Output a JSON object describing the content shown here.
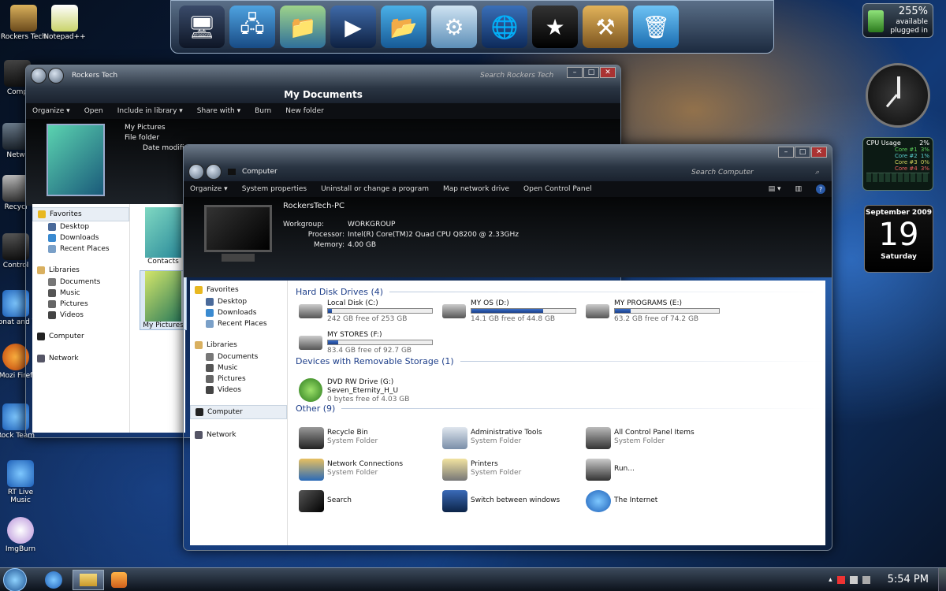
{
  "desktop": {
    "icons": [
      {
        "label": "Rockers Tech"
      },
      {
        "label": "Notepad++"
      },
      {
        "label": "Comp"
      },
      {
        "label": "Netw"
      },
      {
        "label": "Recycl"
      },
      {
        "label": "Control"
      },
      {
        "label": "Donat and Vi"
      },
      {
        "label": "Mozi Firef"
      },
      {
        "label": "Rock Team"
      },
      {
        "label": "RT Live Music"
      },
      {
        "label": "ImgBurn"
      }
    ]
  },
  "battery": {
    "percent": "255%",
    "status1": "available",
    "status2": "plugged in"
  },
  "cpu": {
    "title": "CPU Usage",
    "total": "2%",
    "cores": [
      {
        "name": "Core #1",
        "val": "3%"
      },
      {
        "name": "Core #2",
        "val": "1%"
      },
      {
        "name": "Core #3",
        "val": "0%"
      },
      {
        "name": "Core #4",
        "val": "3%"
      }
    ]
  },
  "calendar": {
    "month": "September 2009",
    "day": "19",
    "weekday": "Saturday"
  },
  "mydocs": {
    "address": "Rockers Tech",
    "title": "My Documents",
    "search": "Search Rockers Tech",
    "toolbar": [
      "Organize ▾",
      "Open",
      "Include in library ▾",
      "Share with ▾",
      "Burn",
      "New folder"
    ],
    "detail": {
      "name": "My Pictures",
      "type": "File folder",
      "date_label": "Date modified:"
    },
    "nav": {
      "favorites": "Favorites",
      "fav_items": [
        "Desktop",
        "Downloads",
        "Recent Places"
      ],
      "libraries": "Libraries",
      "lib_items": [
        "Documents",
        "Music",
        "Pictures",
        "Videos"
      ],
      "computer": "Computer",
      "network": "Network"
    },
    "folders": [
      "Contacts",
      "My Pictures"
    ]
  },
  "computer": {
    "address": "Computer",
    "search": "Search Computer",
    "toolbar": [
      "Organize ▾",
      "System properties",
      "Uninstall or change a program",
      "Map network drive",
      "Open Control Panel"
    ],
    "info": {
      "name": "RockersTech-PC",
      "workgroup_label": "Workgroup:",
      "workgroup": "WORKGROUP",
      "processor_label": "Processor:",
      "processor": "Intel(R) Core(TM)2 Quad CPU   Q8200  @ 2.33GHz",
      "memory_label": "Memory:",
      "memory": "4.00 GB"
    },
    "nav": {
      "favorites": "Favorites",
      "fav_items": [
        "Desktop",
        "Downloads",
        "Recent Places"
      ],
      "libraries": "Libraries",
      "lib_items": [
        "Documents",
        "Music",
        "Pictures",
        "Videos"
      ],
      "computer": "Computer",
      "network": "Network"
    },
    "groups": {
      "hdd": "Hard Disk Drives (4)",
      "removable": "Devices with Removable Storage (1)",
      "other": "Other (9)"
    },
    "drives": [
      {
        "name": "Local Disk (C:)",
        "free": "242 GB free of 253 GB",
        "used": 0.04
      },
      {
        "name": "MY OS (D:)",
        "free": "14.1 GB free of 44.8 GB",
        "used": 0.69
      },
      {
        "name": "MY PROGRAMS (E:)",
        "free": "63.2 GB free of 74.2 GB",
        "used": 0.15
      },
      {
        "name": "MY STORES (F:)",
        "free": "83.4 GB free of 92.7 GB",
        "used": 0.1
      }
    ],
    "dvd": {
      "name": "DVD RW Drive (G:)",
      "label": "Seven_Eternity_H_U",
      "free": "0 bytes free of 4.03 GB"
    },
    "others": [
      {
        "name": "Recycle Bin",
        "sub": "System Folder"
      },
      {
        "name": "Administrative Tools",
        "sub": "System Folder"
      },
      {
        "name": "All Control Panel Items",
        "sub": "System Folder"
      },
      {
        "name": "Network Connections",
        "sub": "System Folder"
      },
      {
        "name": "Printers",
        "sub": "System Folder"
      },
      {
        "name": "Run...",
        "sub": ""
      },
      {
        "name": "Search",
        "sub": ""
      },
      {
        "name": "Switch between windows",
        "sub": ""
      },
      {
        "name": "The Internet",
        "sub": ""
      }
    ]
  },
  "taskbar": {
    "time": "5:54 PM"
  }
}
